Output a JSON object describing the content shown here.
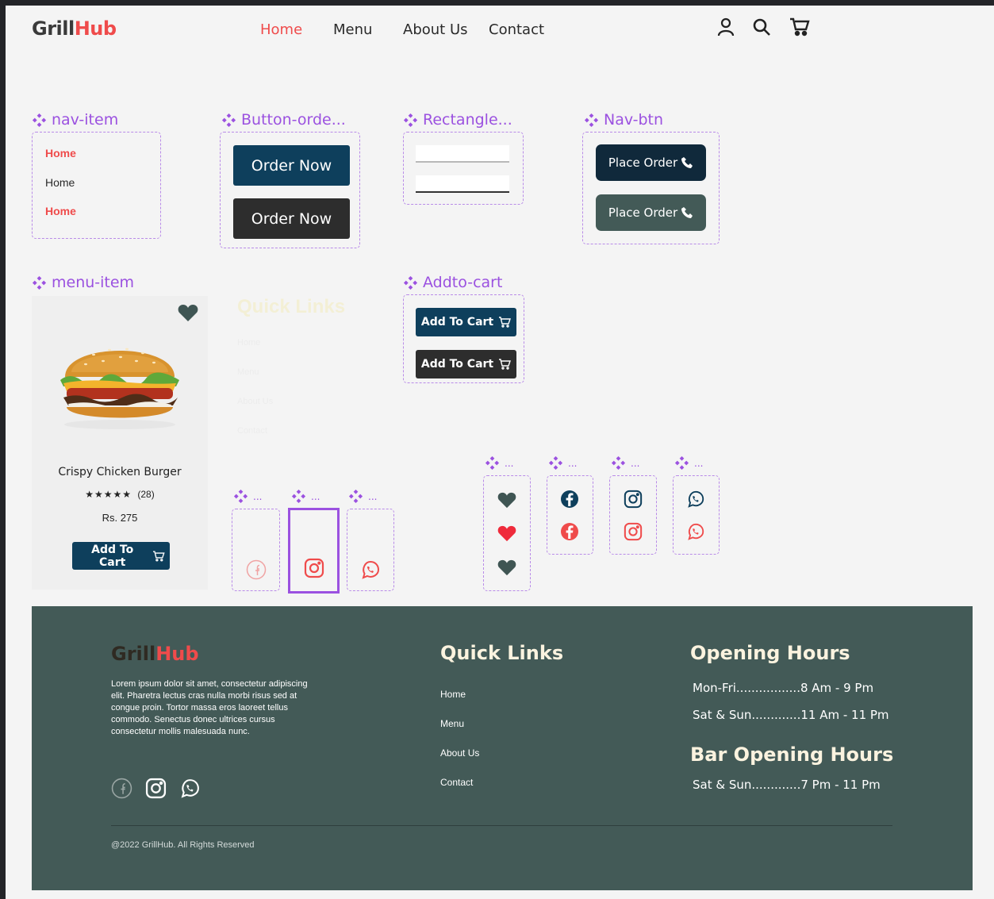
{
  "header": {
    "logo_part1": "Grill",
    "logo_part2": "Hub",
    "nav": [
      "Home",
      "Menu",
      "About Us",
      "Contact"
    ]
  },
  "components": {
    "nav_item": {
      "label": "nav-item",
      "items": [
        "Home",
        "Home",
        "Home"
      ]
    },
    "button_order": {
      "label": "Button-orde...",
      "buttons": [
        "Order Now",
        "Order Now"
      ]
    },
    "rectangle": {
      "label": "Rectangle..."
    },
    "nav_btn": {
      "label": "Nav-btn",
      "buttons": [
        "Place Order",
        "Place Order"
      ]
    },
    "menu_item": {
      "label": "menu-item",
      "name": "Crispy Chicken Burger",
      "stars": "★★★★★",
      "reviews": "(28)",
      "price": "Rs. 275",
      "button": "Add To Cart"
    },
    "addto_cart": {
      "label": "Addto-cart",
      "buttons": [
        "Add To Cart",
        "Add To Cart"
      ]
    },
    "ghost_quick_links": {
      "title": "Quick Links",
      "links": [
        "Home",
        "Menu",
        "About Us",
        "Contact"
      ]
    },
    "small_label": "..."
  },
  "footer": {
    "logo_part1": "Grill",
    "logo_part2": "Hub",
    "description": "Lorem ipsum dolor sit amet, consectetur adipiscing elit. Pharetra lectus cras nulla morbi risus sed at congue proin. Tortor massa eros laoreet tellus commodo. Senectus donec ultrices cursus consectetur mollis malesuada nunc.",
    "quick_links_title": "Quick Links",
    "quick_links": [
      "Home",
      "Menu",
      "About Us",
      "Contact"
    ],
    "opening_hours_title": "Opening Hours",
    "opening_hours": [
      "Mon-Fri.................8 Am - 9 Pm",
      "Sat & Sun.............11 Am - 11 Pm"
    ],
    "bar_hours_title": "Bar Opening Hours",
    "bar_hours": [
      "Sat & Sun.............7 Pm - 11 Pm"
    ],
    "copyright": "@2022 GrillHub. All Rights Reserved"
  },
  "colors": {
    "accent_red": "#ef4b4b",
    "navy": "#0e3f5c",
    "dark": "#2d2d2d",
    "footer_bg": "#435a57",
    "figma_purple": "#9b51e0"
  }
}
